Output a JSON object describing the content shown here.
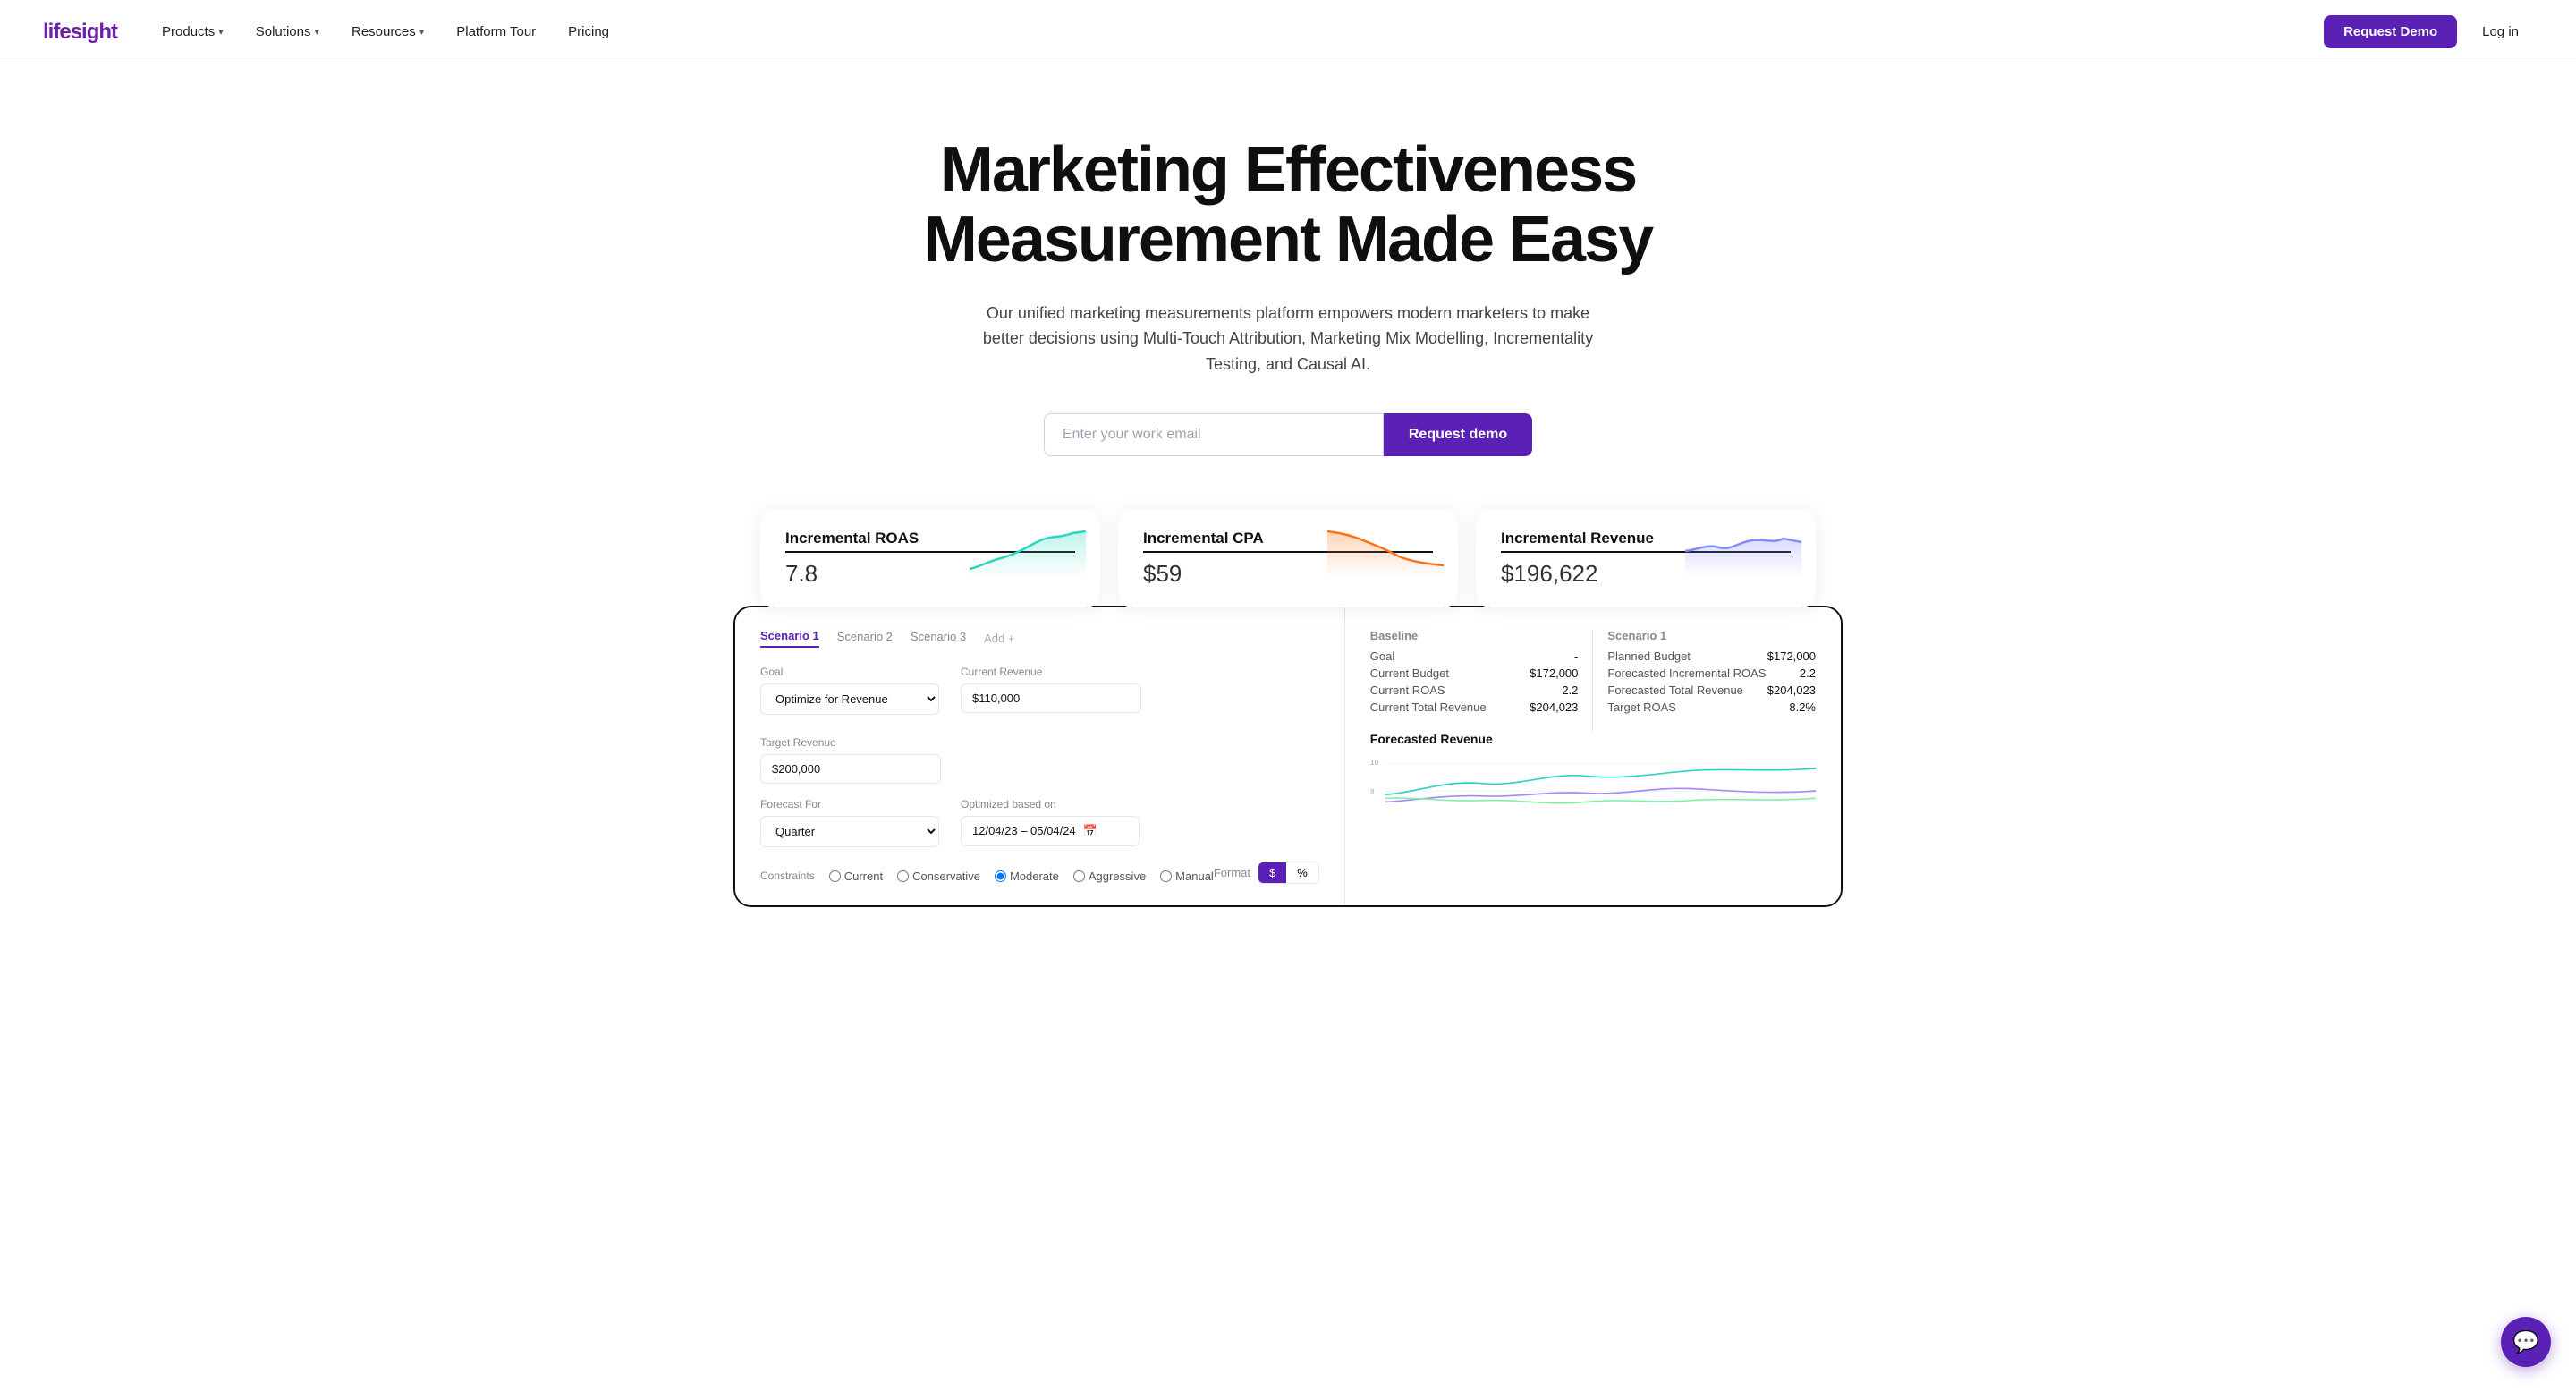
{
  "brand": {
    "name": "lifesight",
    "logo_display": "lifesight"
  },
  "nav": {
    "links": [
      {
        "label": "Products",
        "has_dropdown": true
      },
      {
        "label": "Solutions",
        "has_dropdown": true
      },
      {
        "label": "Resources",
        "has_dropdown": true
      },
      {
        "label": "Platform Tour",
        "has_dropdown": false
      },
      {
        "label": "Pricing",
        "has_dropdown": false
      }
    ],
    "cta": "Request Demo",
    "login": "Log in"
  },
  "hero": {
    "heading": "Marketing Effectiveness Measurement Made Easy",
    "subheading": "Our unified marketing measurements platform empowers modern marketers to make better decisions using Multi-Touch Attribution, Marketing Mix Modelling, Incrementality Testing, and Causal AI.",
    "email_placeholder": "Enter your work email",
    "cta_button": "Request demo"
  },
  "metrics": [
    {
      "title": "Incremental ROAS",
      "value": "7.8",
      "chart_color": "#2dd4bf",
      "chart_fill": "rgba(45,212,191,0.15)",
      "chart_type": "line_up"
    },
    {
      "title": "Incremental CPA",
      "value": "$59",
      "chart_color": "#f97316",
      "chart_fill": "rgba(249,115,22,0.15)",
      "chart_type": "line_down"
    },
    {
      "title": "Incremental Revenue",
      "value": "$196,622",
      "chart_color": "#818cf8",
      "chart_fill": "rgba(129,140,248,0.15)",
      "chart_type": "line_mixed"
    }
  ],
  "dashboard": {
    "tabs": [
      "Scenario 1",
      "Scenario 2",
      "Scenario 3"
    ],
    "add_label": "Add +",
    "active_tab": 0,
    "form": {
      "goal_label": "Goal",
      "goal_value": "Optimize for Revenue",
      "current_revenue_label": "Current Revenue",
      "current_revenue_value": "$110,000",
      "target_revenue_label": "Target Revenue",
      "target_revenue_value": "$200,000",
      "forecast_for_label": "Forecast For",
      "forecast_for_value": "Quarter",
      "optimized_based_on_label": "Optimized based on",
      "date_range": "12/04/23 – 05/04/24",
      "constraints_label": "Constraints",
      "constraint_options": [
        "Current",
        "Conservative",
        "Moderate",
        "Aggressive",
        "Manual"
      ],
      "active_constraint": "Moderate",
      "format_label": "Format",
      "format_options": [
        "$",
        "%"
      ]
    },
    "baseline": {
      "title": "Baseline",
      "rows": [
        {
          "label": "Goal",
          "value": "-"
        },
        {
          "label": "Current Budget",
          "value": "$172,000"
        },
        {
          "label": "Current ROAS",
          "value": "2.2"
        },
        {
          "label": "Current Total Revenue",
          "value": "$204,023"
        }
      ]
    },
    "scenario": {
      "title": "Scenario 1",
      "rows": [
        {
          "label": "Planned Budget",
          "value": "$172,000"
        },
        {
          "label": "Forecasted Incremental ROAS",
          "value": "2.2"
        },
        {
          "label": "Forecasted Total Revenue",
          "value": "$204,023"
        },
        {
          "label": "Target ROAS",
          "value": "8.2%"
        }
      ]
    },
    "forecasted_revenue_title": "Forecasted Revenue",
    "forecasted_y_labels": [
      "10",
      "8"
    ]
  },
  "chat": {
    "icon": "💬"
  }
}
